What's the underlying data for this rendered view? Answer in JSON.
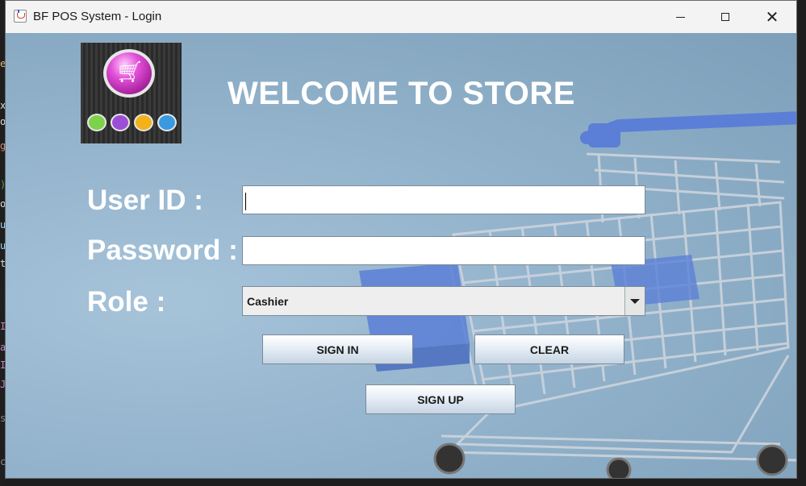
{
  "window": {
    "title": "BF POS System - Login"
  },
  "header": {
    "welcome": "WELCOME TO STORE"
  },
  "form": {
    "user_id_label": "User ID :",
    "user_id_value": "",
    "password_label": "Password :",
    "password_value": "",
    "role_label": "Role :",
    "role_value": "Cashier"
  },
  "buttons": {
    "sign_in": "SIGN IN",
    "clear": "CLEAR",
    "sign_up": "SIGN UP"
  },
  "colors": {
    "text_white": "#ffffff",
    "background": "#93b3cc",
    "logo_main": "#e24fd7",
    "cart_handle": "#5b7fd6"
  },
  "icons": {
    "app": "java-icon",
    "logo": "shopping-cart-icon"
  }
}
